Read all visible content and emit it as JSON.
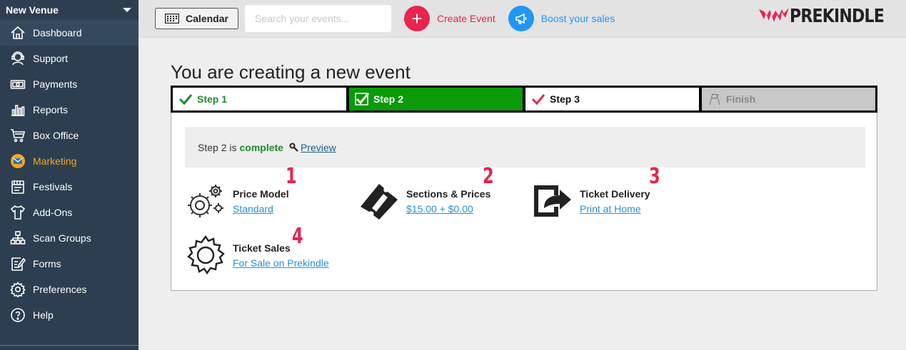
{
  "sidebar": {
    "venue": "New Venue",
    "items": [
      {
        "label": "Dashboard",
        "icon": "home-icon"
      },
      {
        "label": "Support",
        "icon": "support-icon"
      },
      {
        "label": "Payments",
        "icon": "payments-icon"
      },
      {
        "label": "Reports",
        "icon": "reports-icon"
      },
      {
        "label": "Box Office",
        "icon": "cart-icon"
      },
      {
        "label": "Marketing",
        "icon": "marketing-icon"
      },
      {
        "label": "Festivals",
        "icon": "festivals-icon"
      },
      {
        "label": "Add-Ons",
        "icon": "shirt-icon"
      },
      {
        "label": "Scan Groups",
        "icon": "scan-groups-icon"
      },
      {
        "label": "Forms",
        "icon": "forms-icon"
      },
      {
        "label": "Preferences",
        "icon": "gear-icon"
      },
      {
        "label": "Help",
        "icon": "help-icon"
      }
    ]
  },
  "topbar": {
    "calendar_label": "Calendar",
    "search_placeholder": "Search your events...",
    "create_label": "Create Event",
    "boost_label": "Boost your sales",
    "logo_text": "PREKINDLE"
  },
  "main": {
    "title": "You are creating a new event",
    "steps": [
      "Step 1",
      "Step 2",
      "Step 3",
      "Finish"
    ],
    "status": {
      "prefix": "Step 2 is",
      "state": "complete",
      "preview_label": "Preview"
    },
    "items": [
      {
        "title": "Price Model",
        "value": "Standard",
        "number": "1"
      },
      {
        "title": "Sections & Prices",
        "value": "$15.00 + $0.00",
        "number": "2"
      },
      {
        "title": "Ticket Delivery",
        "value": "Print at Home",
        "number": "3"
      },
      {
        "title": "Ticket Sales",
        "value": "For Sale on Prekindle",
        "number": "4"
      }
    ]
  },
  "colors": {
    "sidebar_bg": "#2c3e50",
    "accent_red": "#e8244f",
    "accent_blue": "#2196f3",
    "success_green": "#0a9a0a",
    "marketing_orange": "#f5a623"
  }
}
